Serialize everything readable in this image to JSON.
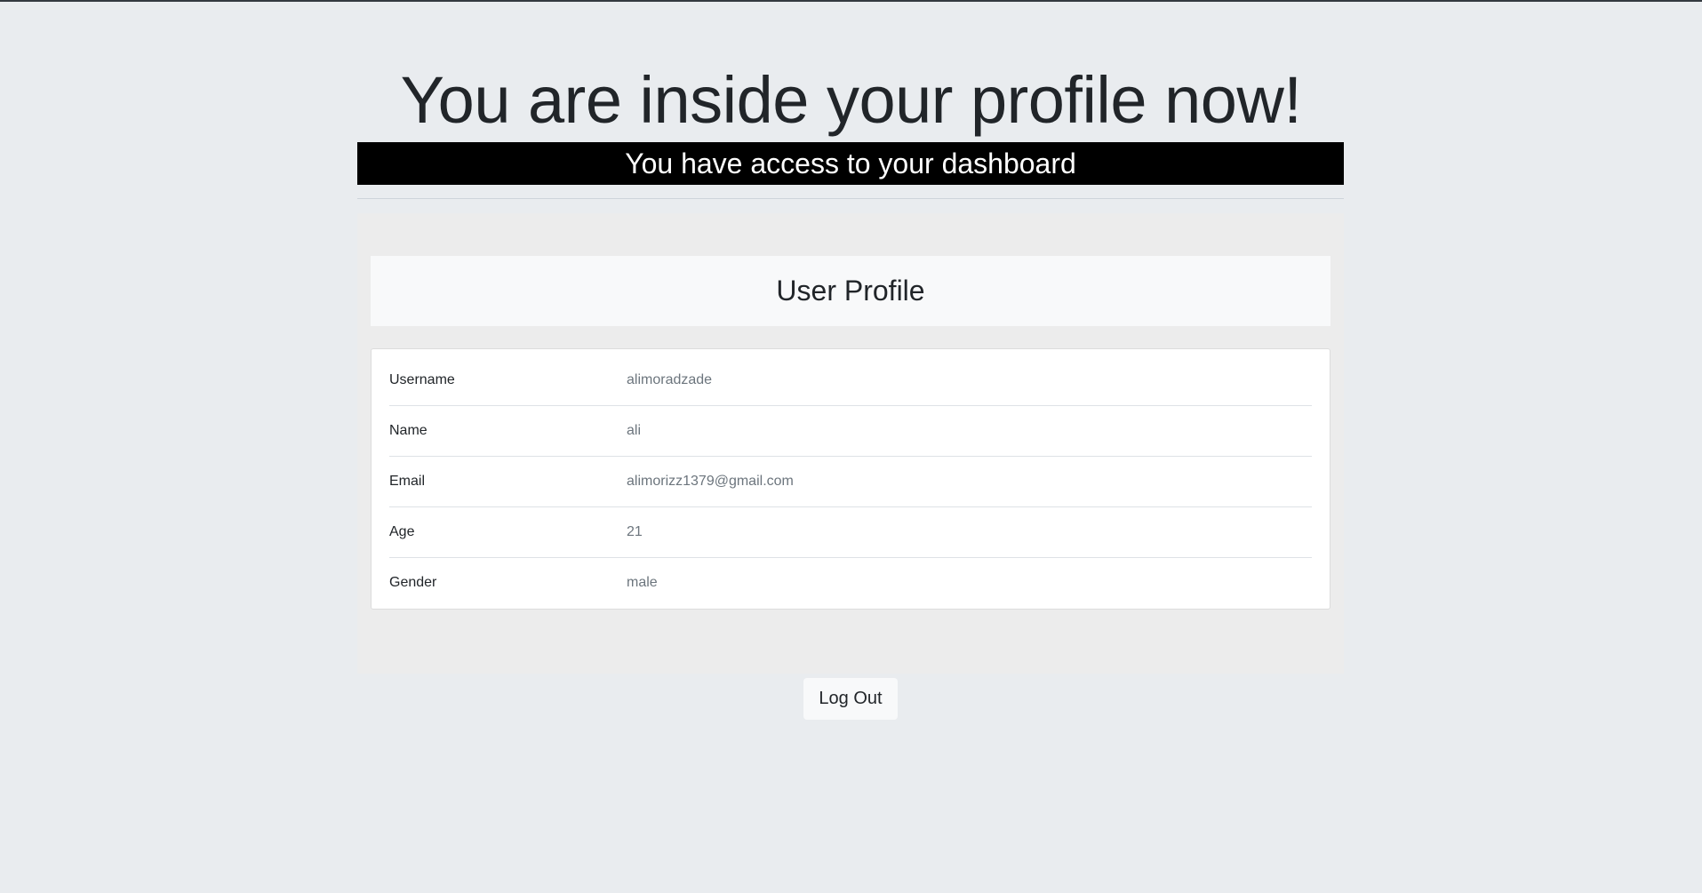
{
  "header": {
    "title": "You are inside your profile now!",
    "banner": "You have access to your dashboard"
  },
  "profile": {
    "title": "User Profile",
    "fields": [
      {
        "label": "Username",
        "value": "alimoradzade"
      },
      {
        "label": "Name",
        "value": "ali"
      },
      {
        "label": "Email",
        "value": "alimorizz1379@gmail.com"
      },
      {
        "label": "Age",
        "value": "21"
      },
      {
        "label": "Gender",
        "value": "male"
      }
    ]
  },
  "actions": {
    "logout_label": "Log Out"
  },
  "colors": {
    "page_bg": "#e9ecef",
    "banner_bg": "#000000",
    "banner_text": "#ffffff",
    "muted_text": "#6c757d"
  }
}
